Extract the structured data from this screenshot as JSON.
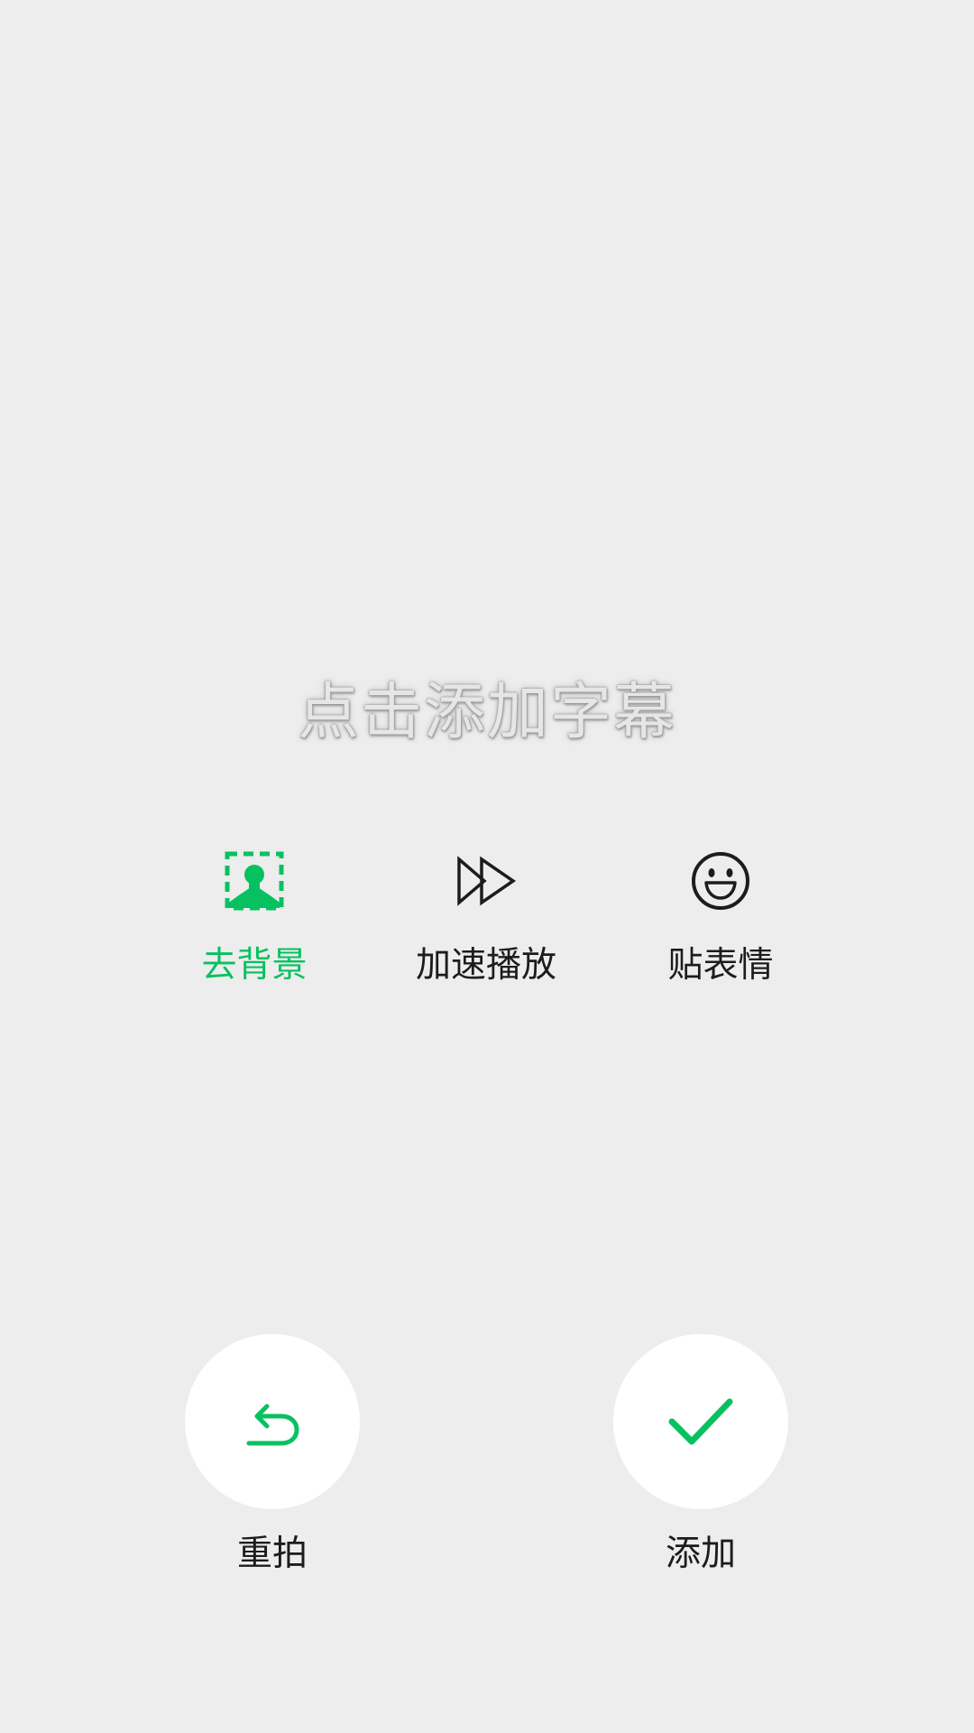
{
  "subtitle": {
    "hint": "点击添加字幕"
  },
  "tools": [
    {
      "label": "去背景",
      "icon": "person-background-remove-icon",
      "active": true
    },
    {
      "label": "加速播放",
      "icon": "fast-forward-icon",
      "active": false
    },
    {
      "label": "贴表情",
      "icon": "smiley-icon",
      "active": false
    }
  ],
  "actions": {
    "retake": {
      "label": "重拍",
      "icon": "undo-arrow-icon"
    },
    "add": {
      "label": "添加",
      "icon": "checkmark-icon"
    }
  },
  "colors": {
    "background": "#ededed",
    "accent": "#07c160",
    "text": "#1c1c1c",
    "button": "#ffffff"
  }
}
